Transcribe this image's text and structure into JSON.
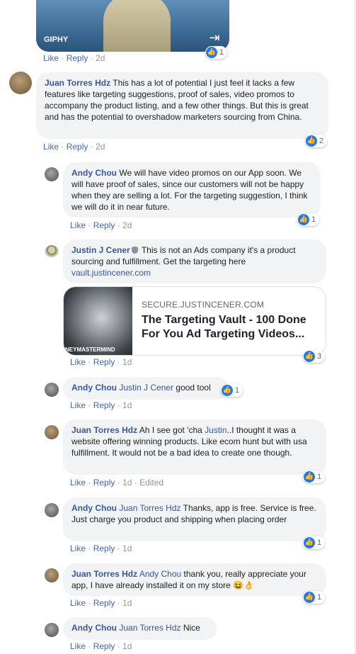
{
  "gif": {
    "label": "GIPHY",
    "expand_icon": "expand-icon"
  },
  "colors": {
    "name": "#385898",
    "like_blue": "#2078f4",
    "bubble": "#f2f3f5",
    "meta": "#90949c"
  },
  "comments": [
    {
      "actions": {
        "like": "Like",
        "reply": "Reply",
        "time": "2d"
      },
      "reactions": "1"
    },
    {
      "name": "Juan Torres Hdz",
      "text": "This has a lot of potential I just feel it lacks a few features like targeting suggestions, proof of sales, video promos to accompany the product listing, and a few other things. But this is great and has the potential to overshadow marketers sourcing from China.",
      "actions": {
        "like": "Like",
        "reply": "Reply",
        "time": "2d"
      },
      "reactions": "2"
    },
    {
      "name": "Andy Chou",
      "text": "We will have video promos on our App soon. We will have proof of sales, since our customers will not be happy when they are selling a lot. For the targeting suggestion, I think we will do it in near future.",
      "actions": {
        "like": "Like",
        "reply": "Reply",
        "time": "2d"
      },
      "reactions": "1"
    },
    {
      "name": "Justin J Cener",
      "text": "This is not an Ads company it's a product sourcing and fulfillment. Get the targeting here",
      "link": "vault.justincener.com",
      "card": {
        "domain": "SECURE.JUSTINCENER.COM",
        "title": "The Targeting Vault - 100 Done For You Ad Targeting Videos...",
        "thumb_text": "NEYMASTERMIND"
      },
      "actions": {
        "like": "Like",
        "reply": "Reply",
        "time": "1d"
      },
      "reactions": "3"
    },
    {
      "name": "Andy Chou",
      "mention": "Justin J Cener",
      "text": "good tool",
      "actions": {
        "like": "Like",
        "reply": "Reply",
        "time": "1d"
      },
      "reactions": "1"
    },
    {
      "name": "Juan Torres Hdz",
      "text_pre": "Ah I see got 'cha",
      "mention": "Justin",
      "text": "..I thought it was a website offering winning products. Like ecom hunt but with usa fulfillment. It would not be a bad idea to create one though.",
      "actions": {
        "like": "Like",
        "reply": "Reply",
        "time": "1d",
        "edited": "Edited"
      },
      "reactions": "1"
    },
    {
      "name": "Andy Chou",
      "mention": "Juan Torres Hdz",
      "text": "Thanks, app is free. Service is free. Just charge you product and shipping when placing order",
      "actions": {
        "like": "Like",
        "reply": "Reply",
        "time": "1d"
      },
      "reactions": "1"
    },
    {
      "name": "Juan Torres Hdz",
      "mention": "Andy Chou",
      "text": "thank you, really appreciate your app, I have already installed it on my store 😆👌",
      "actions": {
        "like": "Like",
        "reply": "Reply",
        "time": "1d"
      },
      "reactions": "1"
    },
    {
      "name": "Andy Chou",
      "mention": "Juan Torres Hdz",
      "text": "Nice",
      "actions": {
        "like": "Like",
        "reply": "Reply",
        "time": "1d"
      }
    }
  ]
}
